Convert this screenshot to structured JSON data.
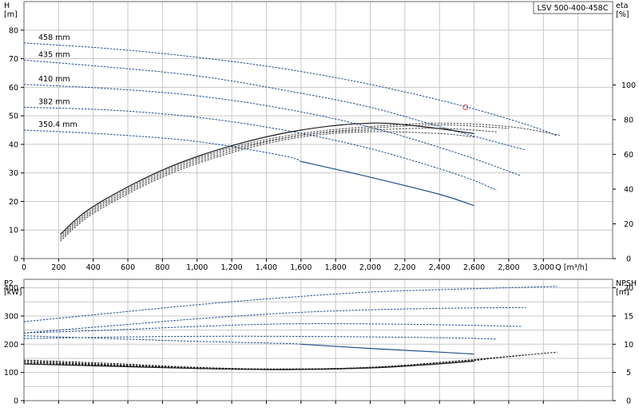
{
  "chart_data": [
    {
      "type": "line",
      "panel": "head-efficiency",
      "title": "LSV 500-400-458C",
      "ylabel_left": "H\n[m]",
      "ylabel_right": "eta\n[%]",
      "xlabel": "Q [m³/h]",
      "xlim": [
        0,
        3400
      ],
      "ylim_left": [
        0,
        90
      ],
      "ylim_right": [
        0,
        148
      ],
      "x_ticks": [
        0,
        200,
        400,
        600,
        800,
        1000,
        1200,
        1400,
        1600,
        1800,
        2000,
        2200,
        2400,
        2600,
        2800,
        3000
      ],
      "x_tick_labels": [
        "0",
        "200",
        "400",
        "600",
        "800",
        "1,000",
        "1,200",
        "1,400",
        "1,600",
        "1,800",
        "2,000",
        "2,200",
        "2,400",
        "2,600",
        "2,800",
        "3,000"
      ],
      "y_ticks_left": [
        0,
        10,
        20,
        30,
        40,
        50,
        60,
        70,
        80
      ],
      "y_ticks_right": [
        0,
        20,
        40,
        60,
        80,
        100
      ],
      "grid": true,
      "series": [
        {
          "name": "458 mm",
          "style": "dashed",
          "color": "#1f4e8c",
          "x": [
            0,
            500,
            1000,
            1500,
            2000,
            2500,
            2900,
            3080
          ],
          "y": [
            75.5,
            73.5,
            70.5,
            66.5,
            61,
            54,
            47,
            43
          ]
        },
        {
          "name": "435 mm",
          "style": "dashed",
          "color": "#1f4e8c",
          "x": [
            0,
            500,
            1000,
            1500,
            2000,
            2500,
            2900
          ],
          "y": [
            69.5,
            67,
            64,
            59,
            53,
            44.5,
            38
          ]
        },
        {
          "name": "410 mm",
          "style": "dashed",
          "color": "#1f4e8c",
          "x": [
            0,
            500,
            1000,
            1500,
            2000,
            2500,
            2870
          ],
          "y": [
            61,
            59.5,
            57,
            52.5,
            46,
            37,
            29
          ]
        },
        {
          "name": "382 mm",
          "style": "dashed",
          "color": "#1f4e8c",
          "x": [
            0,
            500,
            1000,
            1500,
            2000,
            2500,
            2730
          ],
          "y": [
            53,
            52,
            49.5,
            45,
            38.5,
            29.5,
            24
          ]
        },
        {
          "name": "350.4 mm",
          "style": "dashed",
          "color": "#1f4e8c",
          "x": [
            0,
            500,
            1000,
            1500,
            1600
          ],
          "y": [
            45,
            43.5,
            41,
            36,
            34
          ]
        },
        {
          "name": "",
          "style": "solid",
          "color": "#1f4e8c",
          "x": [
            1600,
            2000,
            2400,
            2600
          ],
          "y": [
            34,
            28.5,
            22.5,
            18.5
          ]
        },
        {
          "name": "",
          "style": "solid",
          "color": "#1a1a1a",
          "axis": "right",
          "x": [
            210,
            400,
            800,
            1200,
            1600,
            2000,
            2300,
            2600
          ],
          "y": [
            14,
            30,
            51,
            65,
            74,
            78,
            76,
            72
          ]
        },
        {
          "name": "",
          "style": "dashed",
          "color": "#444444",
          "axis": "right",
          "x": [
            210,
            400,
            800,
            1200,
            1600,
            2000,
            2400,
            2800,
            3100
          ],
          "y": [
            13,
            29,
            50,
            64,
            72,
            76,
            78,
            76,
            71
          ]
        },
        {
          "name": "",
          "style": "dashed",
          "color": "#444444",
          "axis": "right",
          "x": [
            210,
            400,
            800,
            1200,
            1600,
            2000,
            2400,
            2800
          ],
          "y": [
            12,
            28,
            49,
            63,
            71,
            75,
            77,
            75
          ]
        },
        {
          "name": "",
          "style": "dashed",
          "color": "#444444",
          "axis": "right",
          "x": [
            210,
            400,
            800,
            1200,
            1600,
            2000,
            2400,
            2730
          ],
          "y": [
            11,
            27,
            48,
            62,
            71,
            74,
            75,
            73
          ]
        },
        {
          "name": "",
          "style": "dashed",
          "color": "#444444",
          "axis": "right",
          "x": [
            210,
            400,
            800,
            1200,
            1600,
            2000,
            2400,
            2600
          ],
          "y": [
            10,
            26,
            47,
            61,
            70,
            73,
            72,
            70
          ]
        }
      ],
      "markers": [
        {
          "x": 2550,
          "y": 53,
          "color": "#e04040",
          "shape": "circle-open"
        }
      ]
    },
    {
      "type": "line",
      "panel": "power-npsh",
      "ylabel_left": "P2\n[kW]",
      "ylabel_right": "NPSH\n[m]",
      "xlim": [
        0,
        3400
      ],
      "ylim_left": [
        0,
        430
      ],
      "ylim_right": [
        0,
        21.5
      ],
      "y_ticks_left": [
        0,
        100,
        200,
        300,
        400
      ],
      "y_ticks_right": [
        0,
        5,
        10,
        15,
        20
      ],
      "grid": true,
      "series": [
        {
          "name": "",
          "style": "dashed",
          "color": "#1f4e8c",
          "x": [
            0,
            500,
            1000,
            1500,
            2000,
            2500,
            3080
          ],
          "y": [
            280,
            310,
            340,
            365,
            385,
            395,
            405
          ]
        },
        {
          "name": "",
          "style": "dashed",
          "color": "#1f4e8c",
          "x": [
            0,
            500,
            1000,
            1500,
            2000,
            2500,
            2900
          ],
          "y": [
            240,
            265,
            290,
            310,
            322,
            328,
            330
          ]
        },
        {
          "name": "",
          "style": "dashed",
          "color": "#1f4e8c",
          "x": [
            0,
            500,
            1000,
            1500,
            2000,
            2500,
            2870
          ],
          "y": [
            240,
            250,
            263,
            272,
            272,
            268,
            263
          ]
        },
        {
          "name": "",
          "style": "dashed",
          "color": "#1f4e8c",
          "x": [
            0,
            500,
            1000,
            1500,
            2000,
            2500,
            2730
          ],
          "y": [
            220,
            225,
            228,
            228,
            226,
            222,
            218
          ]
        },
        {
          "name": "",
          "style": "dashed",
          "color": "#1f4e8c",
          "x": [
            0,
            500,
            1000,
            1500,
            1600
          ],
          "y": [
            230,
            220,
            210,
            203,
            200
          ]
        },
        {
          "name": "",
          "style": "solid",
          "color": "#1f4e8c",
          "x": [
            1600,
            2000,
            2400,
            2600
          ],
          "y": [
            200,
            185,
            172,
            165
          ]
        },
        {
          "name": "",
          "style": "dashed",
          "color": "#1a1a1a",
          "axis": "right",
          "x": [
            0,
            500,
            1000,
            1500,
            2000,
            2500,
            3080
          ],
          "y": [
            7.2,
            6.6,
            5.9,
            5.6,
            5.9,
            7.0,
            8.6
          ]
        },
        {
          "name": "",
          "style": "dashed",
          "color": "#1a1a1a",
          "axis": "right",
          "x": [
            0,
            500,
            1000,
            1500,
            2000,
            2500,
            2900
          ],
          "y": [
            7.0,
            6.4,
            5.8,
            5.6,
            5.9,
            7.0,
            8.1
          ]
        },
        {
          "name": "",
          "style": "dashed",
          "color": "#1a1a1a",
          "axis": "right",
          "x": [
            0,
            500,
            1000,
            1500,
            2000,
            2500,
            2870
          ],
          "y": [
            6.8,
            6.3,
            5.7,
            5.6,
            5.9,
            7.0,
            8.0
          ]
        },
        {
          "name": "",
          "style": "dashed",
          "color": "#1a1a1a",
          "axis": "right",
          "x": [
            0,
            500,
            1000,
            1500,
            2000,
            2500,
            2730
          ],
          "y": [
            6.6,
            6.2,
            5.7,
            5.5,
            5.8,
            6.8,
            7.6
          ]
        },
        {
          "name": "",
          "style": "solid",
          "color": "#1a1a1a",
          "axis": "right",
          "x": [
            0,
            500,
            1000,
            1500,
            2000,
            2300,
            2600
          ],
          "y": [
            6.5,
            6.1,
            5.7,
            5.5,
            5.8,
            6.3,
            7.0
          ]
        }
      ]
    }
  ]
}
